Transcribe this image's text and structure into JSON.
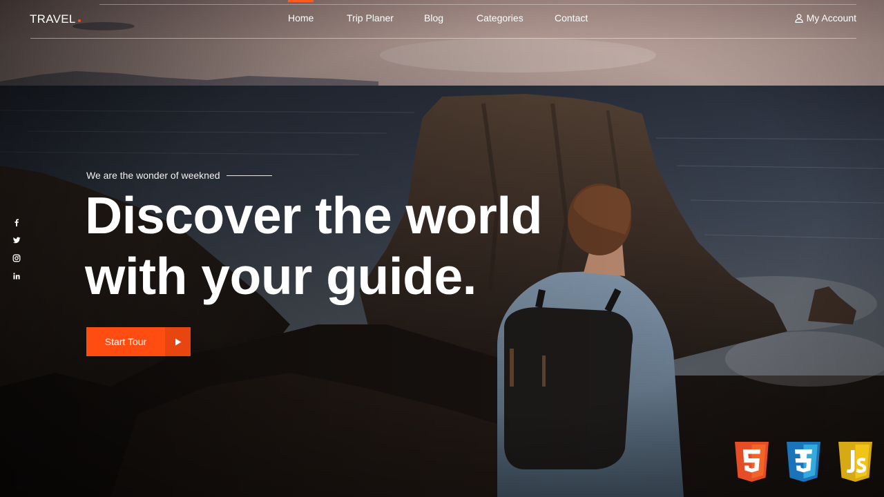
{
  "header": {
    "logo": "TRAVEL",
    "nav": [
      {
        "label": "Home",
        "active": true
      },
      {
        "label": "Trip Planer",
        "active": false
      },
      {
        "label": "Blog",
        "active": false
      },
      {
        "label": "Categories",
        "active": false
      },
      {
        "label": "Contact",
        "active": false
      }
    ],
    "account_label": "My Account",
    "account_icon": "user-icon"
  },
  "social": [
    "facebook-icon",
    "twitter-icon",
    "instagram-icon",
    "linkedin-icon"
  ],
  "hero": {
    "tagline": "We are the wonder of weekned",
    "headline_line1": "Discover the world",
    "headline_line2": "with your guide.",
    "cta_label": "Start Tour",
    "cta_icon": "play-icon"
  },
  "badges": [
    {
      "icon": "html5-icon",
      "text": "5",
      "color": "#e44d26"
    },
    {
      "icon": "css3-icon",
      "text": "3",
      "color": "#1b73ba"
    },
    {
      "icon": "js-icon",
      "text": "JS",
      "color": "#f0c419"
    }
  ],
  "colors": {
    "accent": "#ff4d12",
    "accent_dark": "#e84610",
    "text": "#ffffff"
  }
}
